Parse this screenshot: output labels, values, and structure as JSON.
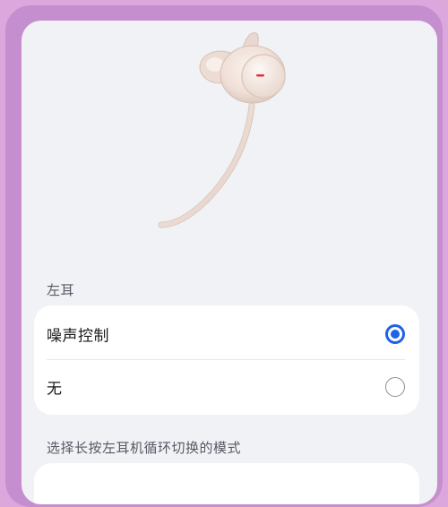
{
  "sections": {
    "left_ear_title": "左耳",
    "cycle_title": "选择长按左耳机循环切换的模式"
  },
  "options": [
    {
      "label": "噪声控制",
      "selected": true
    },
    {
      "label": "无",
      "selected": false
    }
  ],
  "colors": {
    "accent": "#1f63e6",
    "frame_outer": "#dca7dd",
    "frame_inner": "#c58fcf",
    "screen_bg": "#f1f2f5",
    "card_bg": "#ffffff",
    "earbud": "#f0e3dc",
    "earbud_marker": "#e0303a"
  },
  "image": {
    "name": "left-earbud-illustration"
  }
}
